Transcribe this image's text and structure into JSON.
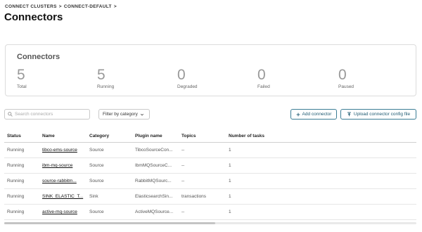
{
  "breadcrumb": {
    "items": [
      "CONNECT CLUSTERS",
      "CONNECT-DEFAULT"
    ],
    "separator": ">",
    "trailing": ">"
  },
  "page_title": "Connectors",
  "summary": {
    "title": "Connectors",
    "metrics": [
      {
        "value": "5",
        "label": "Total"
      },
      {
        "value": "5",
        "label": "Running"
      },
      {
        "value": "0",
        "label": "Degraded"
      },
      {
        "value": "0",
        "label": "Failed"
      },
      {
        "value": "0",
        "label": "Paused"
      }
    ]
  },
  "toolbar": {
    "search_placeholder": "Search connectors",
    "filter_label": "Filter by category",
    "add_label": "Add connector",
    "upload_label": "Upload connector config file"
  },
  "table": {
    "headers": [
      "Status",
      "Name",
      "Category",
      "Plugin name",
      "Topics",
      "Number of tasks"
    ],
    "rows": [
      {
        "status": "Running",
        "name": "tibco-ems-source",
        "category": "Source",
        "plugin": "TibcoSourceCon...",
        "topics": "--",
        "tasks": "1"
      },
      {
        "status": "Running",
        "name": "ibm-mq-source",
        "category": "Source",
        "plugin": "IbmMQSourceC...",
        "topics": "--",
        "tasks": "1"
      },
      {
        "status": "Running",
        "name": "source-rabbitm...",
        "category": "Source",
        "plugin": "RabbitMQSourc...",
        "topics": "--",
        "tasks": "1"
      },
      {
        "status": "Running",
        "name": "SINK_ELASTIC_T...",
        "category": "Sink",
        "plugin": "ElasticsearchSin...",
        "topics": "transactions",
        "tasks": "1"
      },
      {
        "status": "Running",
        "name": "active-mq-source",
        "category": "Source",
        "plugin": "ActiveMQSource...",
        "topics": "--",
        "tasks": "1"
      }
    ]
  },
  "colors": {
    "accent": "#1e5a72",
    "border": "#dcdcdc"
  }
}
